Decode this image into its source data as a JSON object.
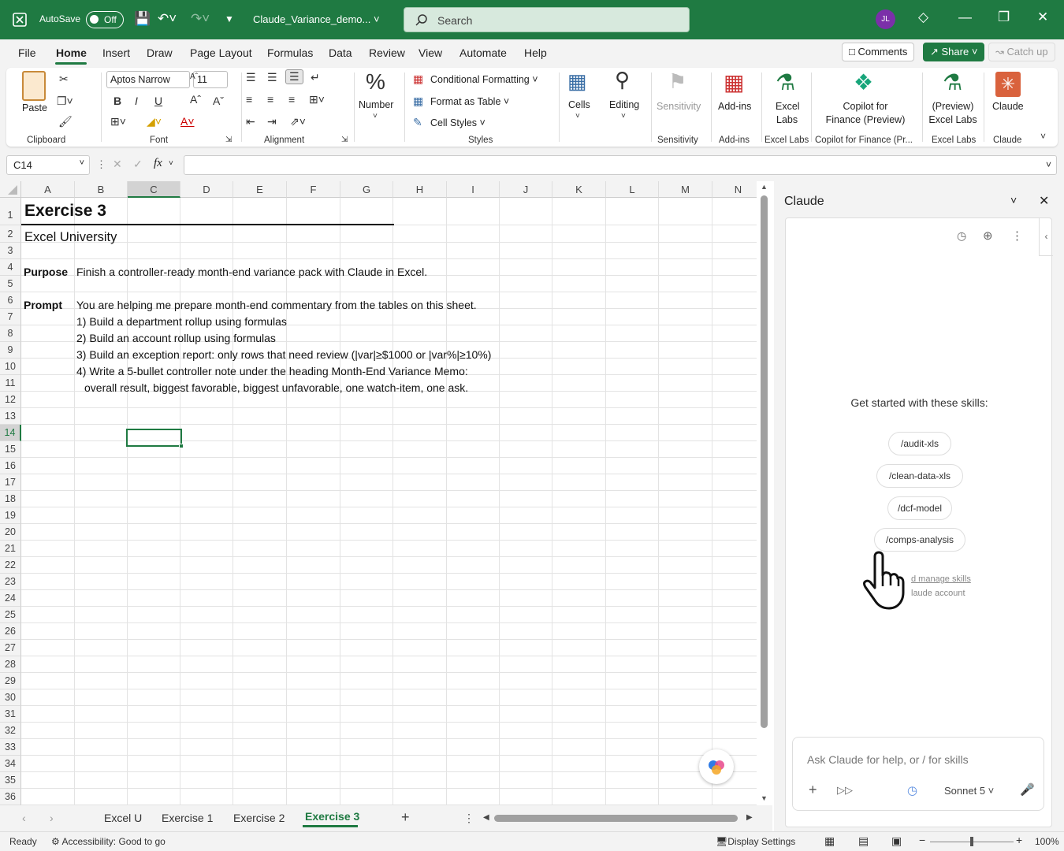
{
  "title_bar": {
    "autosave": "AutoSave",
    "autosave_state": "Off",
    "filename": "Claude_Variance_demo...",
    "search_placeholder": "Search",
    "avatar": "JL"
  },
  "menu": {
    "tabs": [
      "File",
      "Home",
      "Insert",
      "Draw",
      "Page Layout",
      "Formulas",
      "Data",
      "Review",
      "View",
      "Automate",
      "Help"
    ],
    "active": "Home",
    "comments": "Comments",
    "share": "Share",
    "catch_up": "Catch up"
  },
  "ribbon": {
    "paste": "Paste",
    "clipboard": "Clipboard",
    "font_name": "Aptos Narrow",
    "font_size": "11",
    "font": "Font",
    "alignment": "Alignment",
    "number": "Number",
    "cond_fmt": "Conditional Formatting",
    "format_table": "Format as Table",
    "cell_styles": "Cell Styles",
    "styles": "Styles",
    "cells": "Cells",
    "editing": "Editing",
    "sensitivity": "Sensitivity",
    "sensitivity_group": "Sensitivity",
    "addins": "Add-ins",
    "addins_group": "Add-ins",
    "excel_labs_1": "Excel",
    "excel_labs_2": "Labs",
    "excel_labs_group": "Excel Labs",
    "copilot_1": "Copilot for",
    "copilot_2": "Finance (Preview)",
    "copilot_group": "Copilot for Finance (Pr...",
    "preview_labs_1": "(Preview)",
    "preview_labs_2": "Excel Labs",
    "preview_labs_group": "Excel Labs",
    "claude": "Claude",
    "claude_group": "Claude"
  },
  "formula_bar": {
    "name_box": "C14",
    "fx": "fx"
  },
  "columns": [
    "A",
    "B",
    "C",
    "D",
    "E",
    "F",
    "G",
    "H",
    "I",
    "J",
    "K",
    "L",
    "M",
    "N"
  ],
  "rows": [
    "1",
    "2",
    "3",
    "4",
    "5",
    "6",
    "7",
    "8",
    "9",
    "10",
    "11",
    "12",
    "13",
    "14",
    "15",
    "16",
    "17",
    "18",
    "19",
    "20",
    "21",
    "22",
    "23",
    "24",
    "25",
    "26",
    "27",
    "28",
    "29",
    "30",
    "31",
    "32",
    "33",
    "34",
    "35",
    "36"
  ],
  "cells": {
    "a1": "Exercise 3",
    "a2": "Excel University",
    "a4": "Purpose",
    "b4": "Finish a controller-ready month-end variance pack with Claude in Excel.",
    "a6": "Prompt",
    "b6": "You are helping me prepare month-end commentary from the tables on this sheet.",
    "b7": "1) Build a department rollup using formulas",
    "b8": "2) Build an account rollup using formulas",
    "b9": "3) Build an exception report: only rows that need review (|var|≥$1000 or |var%|≥10%)",
    "b10": "4) Write a 5-bullet controller note under the heading Month-End Variance Memo:",
    "b11": "overall result, biggest favorable, biggest unfavorable, one watch-item, one ask."
  },
  "sheet_tabs": [
    "Excel U",
    "Exercise 1",
    "Exercise 2",
    "Exercise 3"
  ],
  "active_sheet": "Exercise 3",
  "claude_panel": {
    "title": "Claude",
    "intro": "Get started with these skills:",
    "skills": [
      "/audit-xls",
      "/clean-data-xls",
      "/dcf-model",
      "/comps-analysis"
    ],
    "link1": "d manage skills",
    "link2": "laude account",
    "input_placeholder": "Ask Claude for help, or / for skills",
    "model": "Sonnet 5"
  },
  "status": {
    "ready": "Ready",
    "accessibility": "Accessibility: Good to go",
    "display": "Display Settings",
    "zoom": "100%"
  }
}
